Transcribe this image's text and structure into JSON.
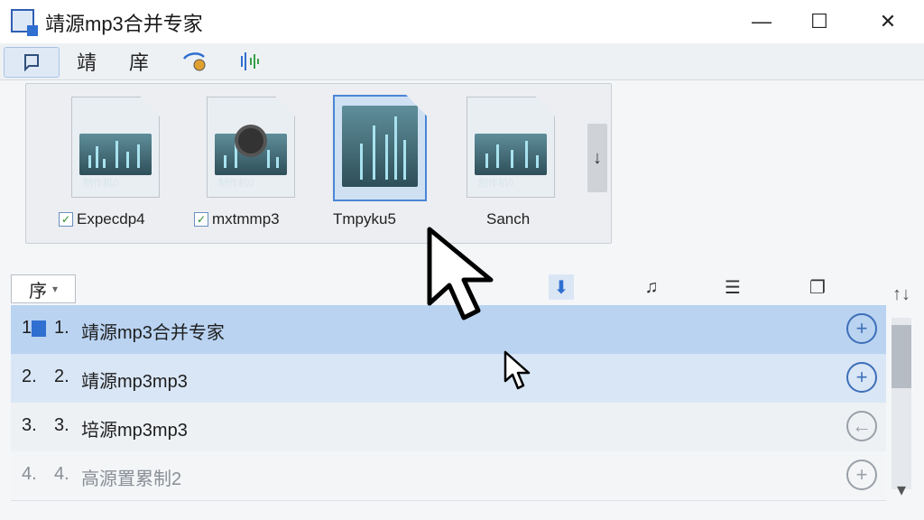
{
  "window": {
    "title": "靖源mp3合并专家",
    "minimize": "—",
    "maximize": "☐",
    "close": "✕"
  },
  "toolbar": {
    "items": [
      "靖",
      "庠"
    ],
    "icons": [
      "file-icon",
      "music-convert-icon",
      "waveform-icon"
    ]
  },
  "thumbnails": [
    {
      "label": "Expecdp4",
      "caption": "制作机0",
      "checked": true
    },
    {
      "label": "mxtmmp3",
      "caption": "制作机0",
      "checked": true
    },
    {
      "label": "Tmpyku5",
      "caption": "",
      "checked": false
    },
    {
      "label": "Sanch",
      "caption": "制作机0",
      "checked": false
    }
  ],
  "thumb_scroll": "↓",
  "columns": {
    "sort_label": "序",
    "sort_arrow": "▾"
  },
  "rows": [
    {
      "idx": "1",
      "num": "1.",
      "name": "靖源mp3合并专家",
      "action": "+"
    },
    {
      "idx": "2.",
      "num": "2.",
      "name": "靖源mp3mp3",
      "action": "+"
    },
    {
      "idx": "3.",
      "num": "3.",
      "name": "培源mp3mp3",
      "action": "←"
    },
    {
      "idx": "4.",
      "num": "4.",
      "name": "高源置累制2",
      "action": "+"
    }
  ],
  "scroll": {
    "up": "↑↓",
    "down": "▾"
  },
  "colors": {
    "accent": "#2f6fd0",
    "selected_row": "#b9d3f1"
  }
}
